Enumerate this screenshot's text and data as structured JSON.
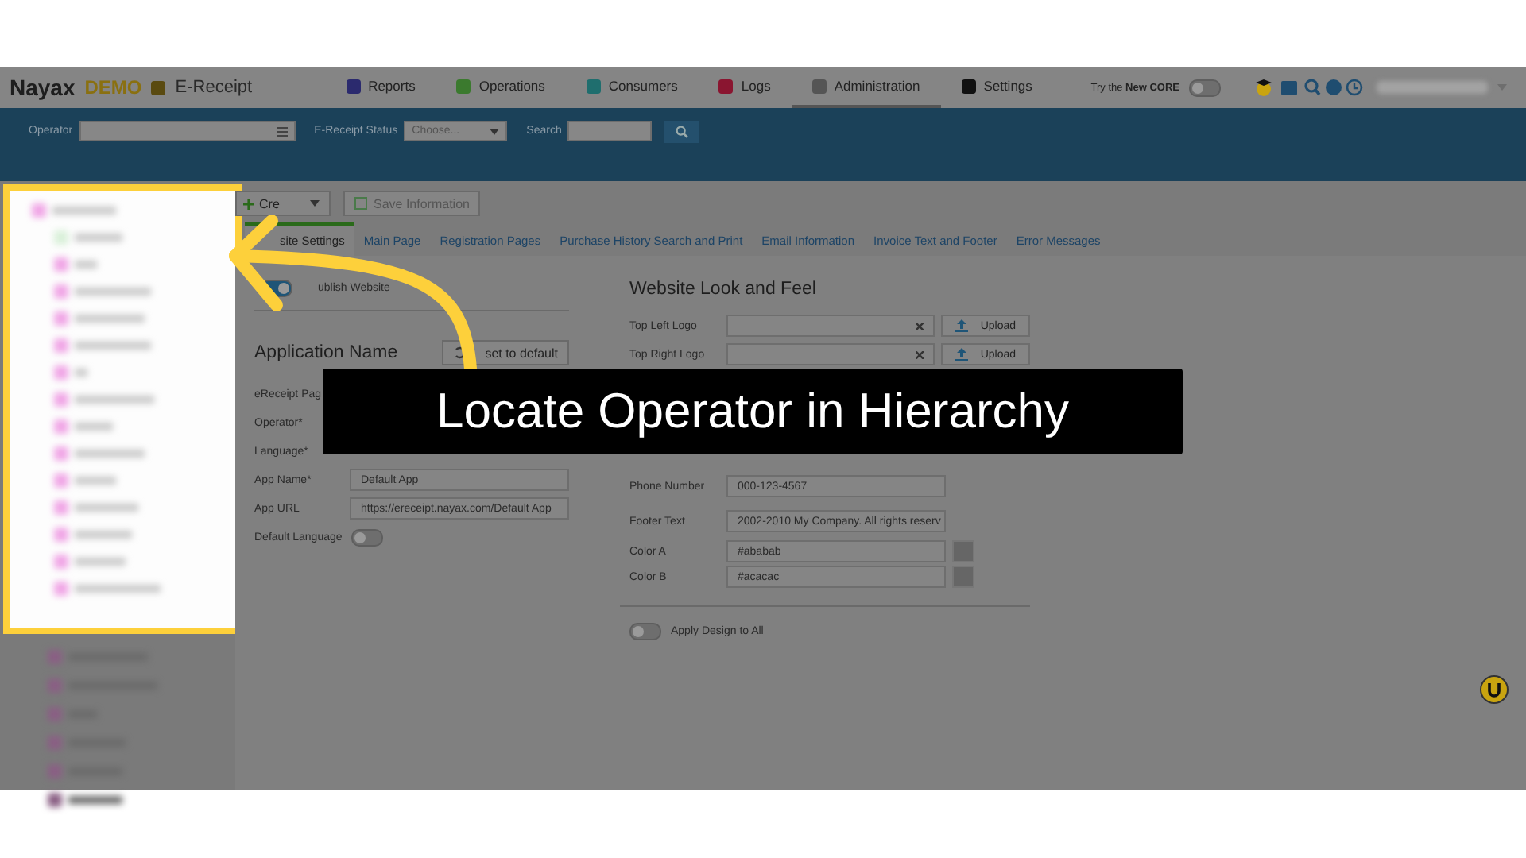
{
  "brand": {
    "logo": "Nayax",
    "badge": "DEMO",
    "product": "E-Receipt"
  },
  "nav": [
    {
      "label": "Reports",
      "selected": false,
      "color": "#2b2a6e"
    },
    {
      "label": "Operations",
      "selected": false,
      "color": "#3b7a2e"
    },
    {
      "label": "Consumers",
      "selected": false,
      "color": "#1f6e6e"
    },
    {
      "label": "Logs",
      "selected": false,
      "color": "#8a1530"
    },
    {
      "label": "Administration",
      "selected": true,
      "color": "#555555"
    },
    {
      "label": "Settings",
      "selected": false,
      "color": "#111111"
    }
  ],
  "core_toggle": {
    "label": "Try the **New CORE**",
    "on": false
  },
  "filter_bar": {
    "operator_label": "Operator",
    "status_label": "E-Receipt Status",
    "status_placeholder": "Choose...",
    "search_label": "Search"
  },
  "toolbar": {
    "create": "Cre",
    "save": "Save Information"
  },
  "tabs": [
    {
      "label": "site Settings",
      "selected": true
    },
    {
      "label": "Main Page",
      "selected": false
    },
    {
      "label": "Registration Pages",
      "selected": false
    },
    {
      "label": "Purchase History Search and Print",
      "selected": false
    },
    {
      "label": "Email Information",
      "selected": false
    },
    {
      "label": "Invoice Text and Footer",
      "selected": false
    },
    {
      "label": "Error Messages",
      "selected": false
    }
  ],
  "publish": {
    "label": "ublish Website",
    "on": true
  },
  "app_section": {
    "title": "Application Name",
    "reset": "set to default",
    "rows": [
      {
        "label": "eReceipt Pag"
      },
      {
        "label": "Operator*"
      },
      {
        "label": "Language*"
      },
      {
        "label": "App Name*",
        "value": "Default App"
      },
      {
        "label": "App URL",
        "value": "https://ereceipt.nayax.com/Default App"
      }
    ],
    "default_language": {
      "label": "Default Language",
      "on": false
    }
  },
  "look_section": {
    "title": "Website Look and Feel",
    "logos": [
      {
        "label": "Top Left Logo",
        "button": "Upload"
      },
      {
        "label": "Top Right Logo",
        "button": "Upload"
      }
    ],
    "fields": [
      {
        "label": "Phone Number",
        "value": "000-123-4567"
      },
      {
        "label": "Footer Text",
        "value": "2002-2010 My Company. All rights reserv"
      }
    ],
    "colors": [
      {
        "label": "Color A",
        "value": "#ababab"
      },
      {
        "label": "Color B",
        "value": "#acacac"
      }
    ],
    "apply_all": {
      "label": "Apply Design to All",
      "on": false
    }
  },
  "caption": "Locate Operator in Hierarchy"
}
